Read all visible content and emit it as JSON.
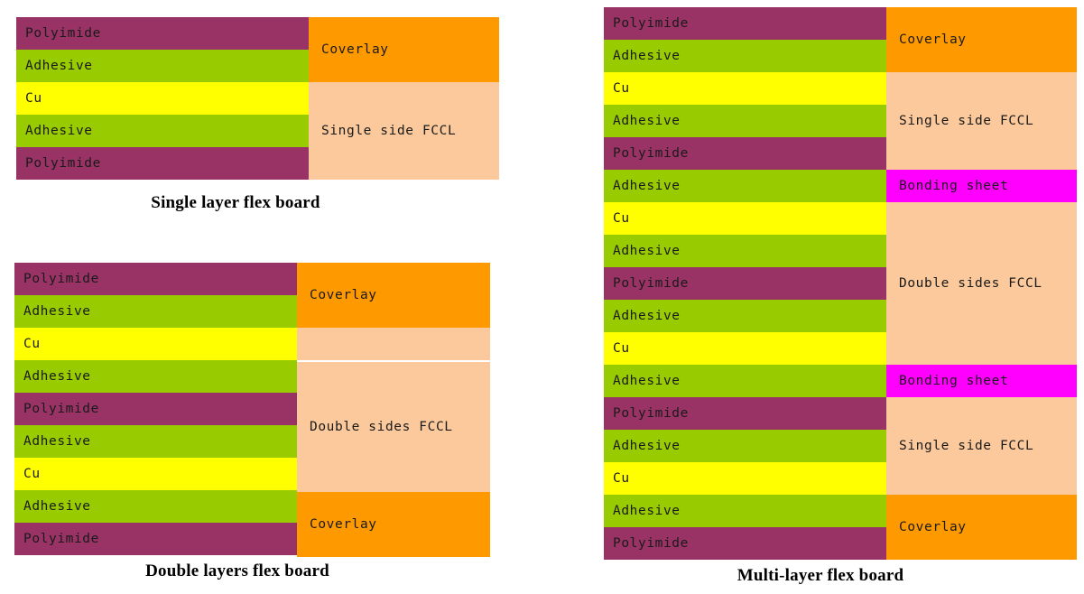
{
  "colors": {
    "polyimide": "#993366",
    "adhesive": "#99cc00",
    "cu": "#ffff00",
    "coverlay": "#ff9900",
    "fccl": "#fbc99b",
    "bonding_sheet": "#ff00ff",
    "background": "#ffffff",
    "text": "#1a1a1a",
    "caption_text": "#000000"
  },
  "labels": {
    "polyimide": "Polyimide",
    "adhesive": "Adhesive",
    "cu": "Cu",
    "coverlay": "Coverlay",
    "single_side_fccl": "Single side FCCL",
    "double_sides_fccl": "Double sides FCCL",
    "bonding_sheet": "Bonding sheet"
  },
  "diagrams": [
    {
      "id": "single",
      "caption": "Single layer flex board",
      "layers": [
        {
          "label": "Polyimide",
          "color": "#993366"
        },
        {
          "label": "Adhesive",
          "color": "#99cc00"
        },
        {
          "label": "Cu",
          "color": "#ffff00"
        },
        {
          "label": "Adhesive",
          "color": "#99cc00"
        },
        {
          "label": "Polyimide",
          "color": "#993366"
        }
      ],
      "groups": [
        {
          "label": "Coverlay",
          "color": "#ff9900",
          "span": 2,
          "split_after": 0
        },
        {
          "label": "Single side FCCL",
          "color": "#fbc99b",
          "span": 3,
          "split_after": 0
        }
      ]
    },
    {
      "id": "double",
      "caption": "Double layers flex board",
      "layers": [
        {
          "label": "Polyimide",
          "color": "#993366"
        },
        {
          "label": "Adhesive",
          "color": "#99cc00"
        },
        {
          "label": "Cu",
          "color": "#ffff00"
        },
        {
          "label": "Adhesive",
          "color": "#99cc00"
        },
        {
          "label": "Polyimide",
          "color": "#993366"
        },
        {
          "label": "Adhesive",
          "color": "#99cc00"
        },
        {
          "label": "Cu",
          "color": "#ffff00"
        },
        {
          "label": "Adhesive",
          "color": "#99cc00"
        },
        {
          "label": "Polyimide",
          "color": "#993366"
        }
      ],
      "groups": [
        {
          "label": "Coverlay",
          "color": "#ff9900",
          "span": 2,
          "split_after": 0
        },
        {
          "label": "Double sides FCCL",
          "color": "#fbc99b",
          "span": 5,
          "split_after": 1
        },
        {
          "label": "Coverlay",
          "color": "#ff9900",
          "span": 2,
          "split_after": 0
        }
      ]
    },
    {
      "id": "multi",
      "caption": "Multi-layer flex board",
      "layers": [
        {
          "label": "Polyimide",
          "color": "#993366"
        },
        {
          "label": "Adhesive",
          "color": "#99cc00"
        },
        {
          "label": "Cu",
          "color": "#ffff00"
        },
        {
          "label": "Adhesive",
          "color": "#99cc00"
        },
        {
          "label": "Polyimide",
          "color": "#993366"
        },
        {
          "label": "Adhesive",
          "color": "#99cc00"
        },
        {
          "label": "Cu",
          "color": "#ffff00"
        },
        {
          "label": "Adhesive",
          "color": "#99cc00"
        },
        {
          "label": "Polyimide",
          "color": "#993366"
        },
        {
          "label": "Adhesive",
          "color": "#99cc00"
        },
        {
          "label": "Cu",
          "color": "#ffff00"
        },
        {
          "label": "Adhesive",
          "color": "#99cc00"
        },
        {
          "label": "Polyimide",
          "color": "#993366"
        },
        {
          "label": "Adhesive",
          "color": "#99cc00"
        },
        {
          "label": "Cu",
          "color": "#ffff00"
        },
        {
          "label": "Adhesive",
          "color": "#99cc00"
        },
        {
          "label": "Polyimide",
          "color": "#993366"
        }
      ],
      "groups": [
        {
          "label": "Coverlay",
          "color": "#ff9900",
          "span": 2,
          "split_after": 0
        },
        {
          "label": "Single side FCCL",
          "color": "#fbc99b",
          "span": 3,
          "split_after": 0
        },
        {
          "label": "Bonding sheet",
          "color": "#ff00ff",
          "span": 1,
          "split_after": 0
        },
        {
          "label": "Double sides FCCL",
          "color": "#fbc99b",
          "span": 5,
          "split_after": 0
        },
        {
          "label": "Bonding sheet",
          "color": "#ff00ff",
          "span": 1,
          "split_after": 0
        },
        {
          "label": "Single side FCCL",
          "color": "#fbc99b",
          "span": 3,
          "split_after": 0
        },
        {
          "label": "Coverlay",
          "color": "#ff9900",
          "span": 2,
          "split_after": 0
        }
      ]
    }
  ]
}
